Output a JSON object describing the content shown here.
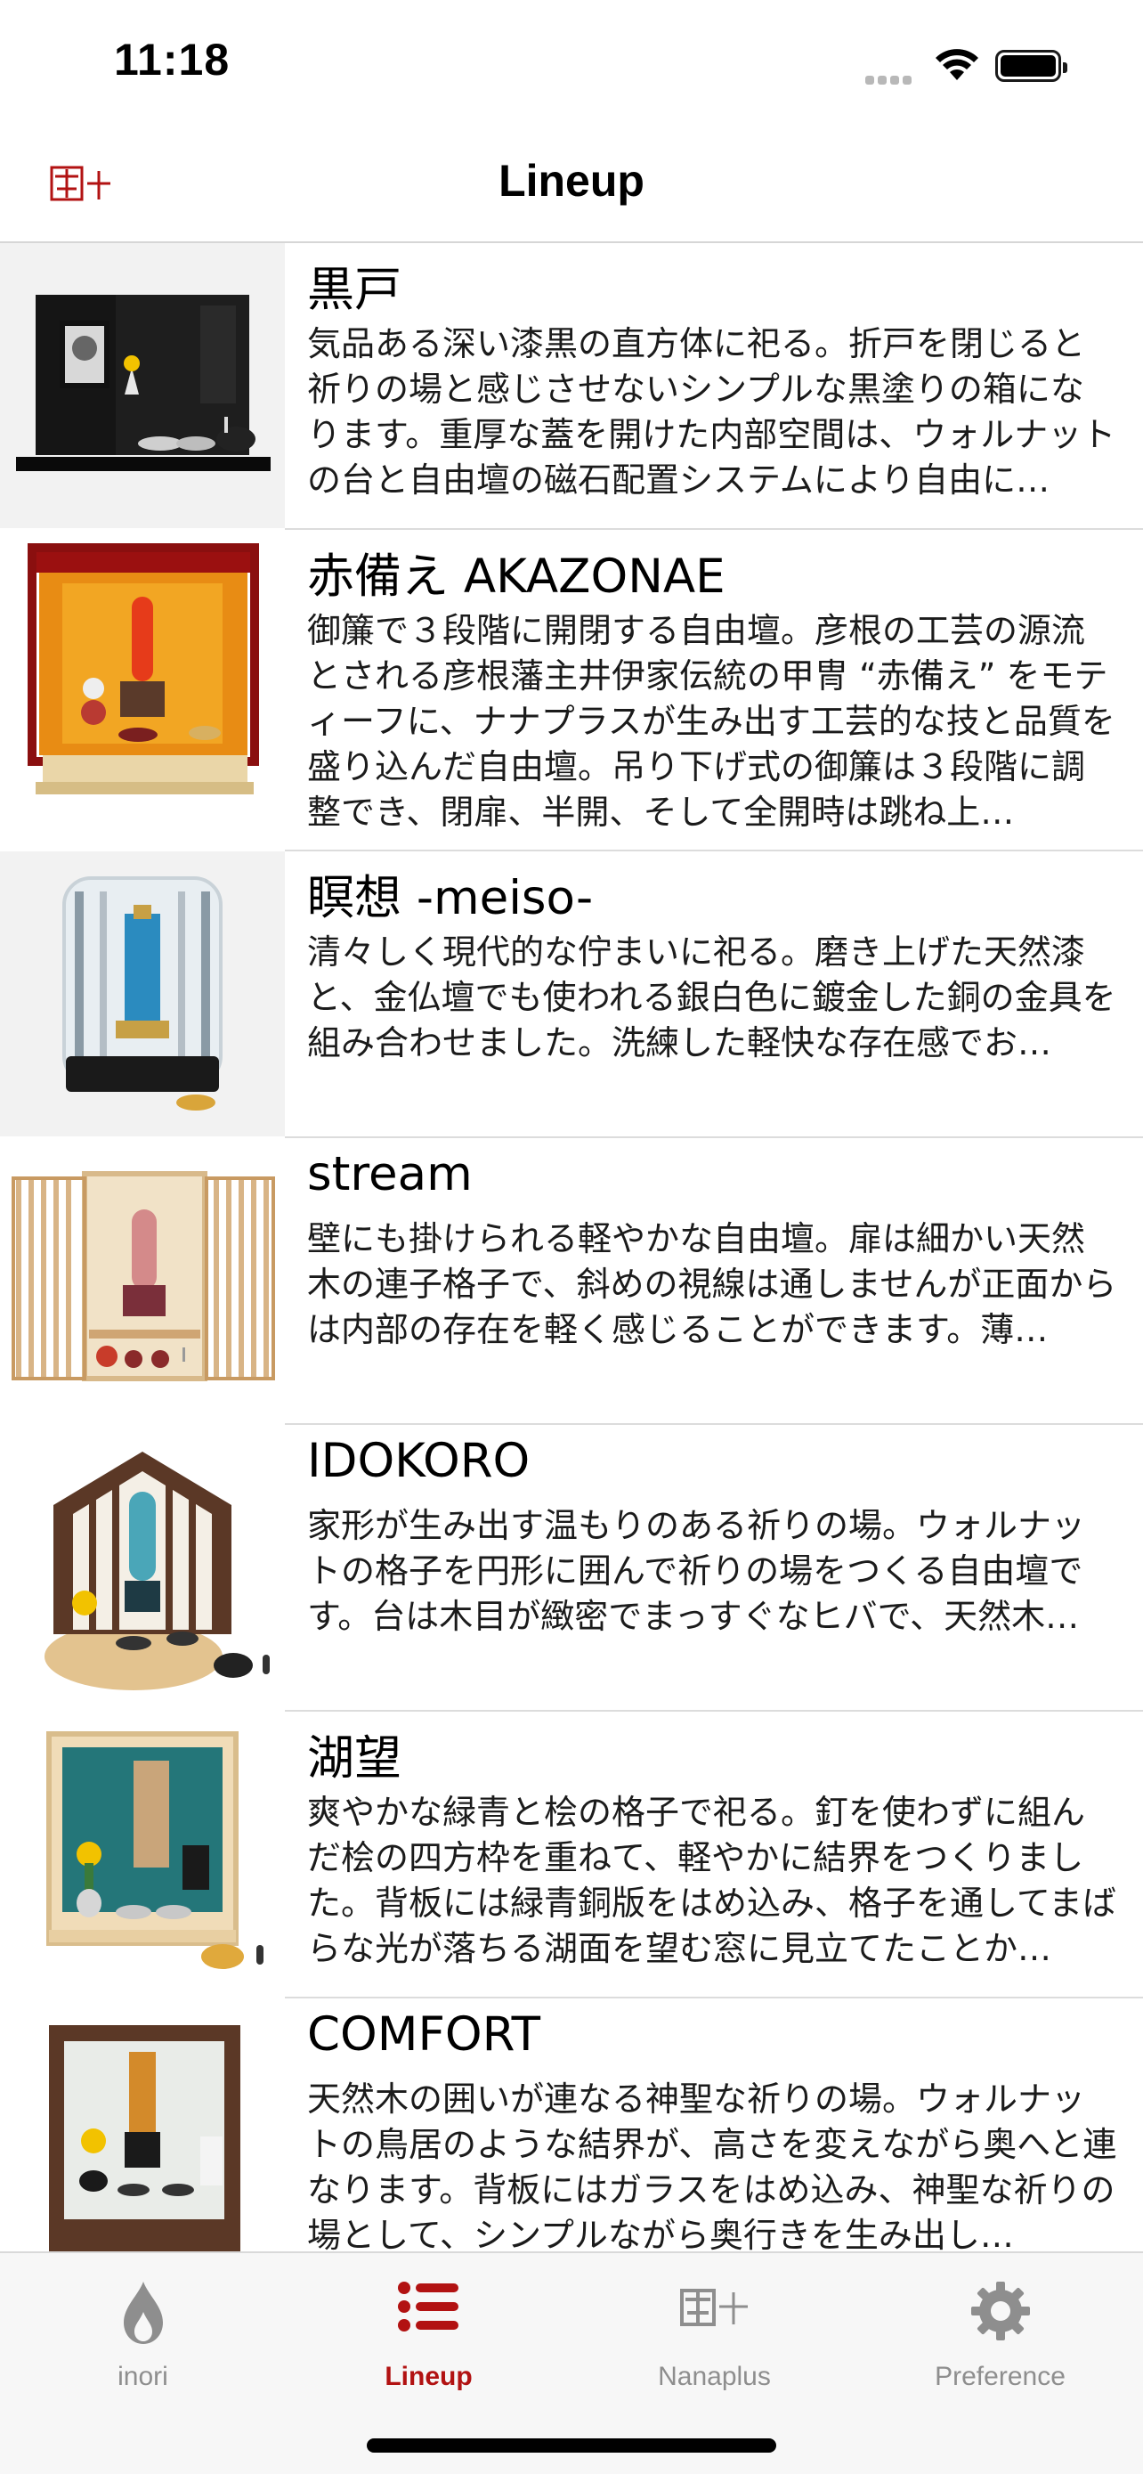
{
  "status": {
    "time": "11:18"
  },
  "nav": {
    "title": "Lineup",
    "logo_text": "菜十"
  },
  "items": [
    {
      "title": "黒戸",
      "description": "気品ある深い漆黒の直方体に祀る。折戸を閉じると祈りの場と感じさせないシンプルな黒塗りの箱になります。重厚な蓋を開けた内部空間は、ウォルナットの台と自由壇の磁石配置システムにより自由に…"
    },
    {
      "title": "赤備え AKAZONAE",
      "description": "御簾で３段階に開閉する自由壇。彦根の工芸の源流とされる彦根藩主井伊家伝統の甲冑 “赤備え” をモティーフに、ナナプラスが生み出す工芸的な技と品質を盛り込んだ自由壇。吊り下げ式の御簾は３段階に調整でき、閉扉、半開、そして全開時は跳ね上…"
    },
    {
      "title": "瞑想 -meiso-",
      "description": "清々しく現代的な佇まいに祀る。磨き上げた天然漆と、金仏壇でも使われる銀白色に鍍金した銅の金具を組み合わせました。洗練した軽快な存在感でお…"
    },
    {
      "title": "stream",
      "description": "壁にも掛けられる軽やかな自由壇。扉は細かい天然木の連子格子で、斜めの視線は通しませんが正面からは内部の存在を軽く感じることができます。薄…"
    },
    {
      "title": "IDOKORO",
      "description": "家形が生み出す温もりのある祈りの場。ウォルナットの格子を円形に囲んで祈りの場をつくる自由壇です。台は木目が緻密でまっすぐなヒバで、天然木…"
    },
    {
      "title": "湖望",
      "description": "爽やかな緑青と桧の格子で祀る。釘を使わずに組んだ桧の四方枠を重ねて、軽やかに結界をつくりました。背板には緑青銅版をはめ込み、格子を通してまばらな光が落ちる湖面を望む窓に見立てたことか…"
    },
    {
      "title": "COMFORT",
      "description": "天然木の囲いが連なる神聖な祈りの場。ウォルナットの鳥居のような結界が、高さを変えながら奥へと連なります。背板にはガラスをはめ込み、神聖な祈りの場として、シンプルながら奥行きを生み出し…"
    }
  ],
  "tabs": [
    {
      "label": "inori",
      "icon": "flame-icon"
    },
    {
      "label": "Lineup",
      "icon": "list-icon"
    },
    {
      "label": "Nanaplus",
      "icon": "nanaplus-logo-icon"
    },
    {
      "label": "Preference",
      "icon": "gear-icon"
    }
  ],
  "colors": {
    "accent": "#b21212",
    "inactive": "#8e8e8e"
  }
}
